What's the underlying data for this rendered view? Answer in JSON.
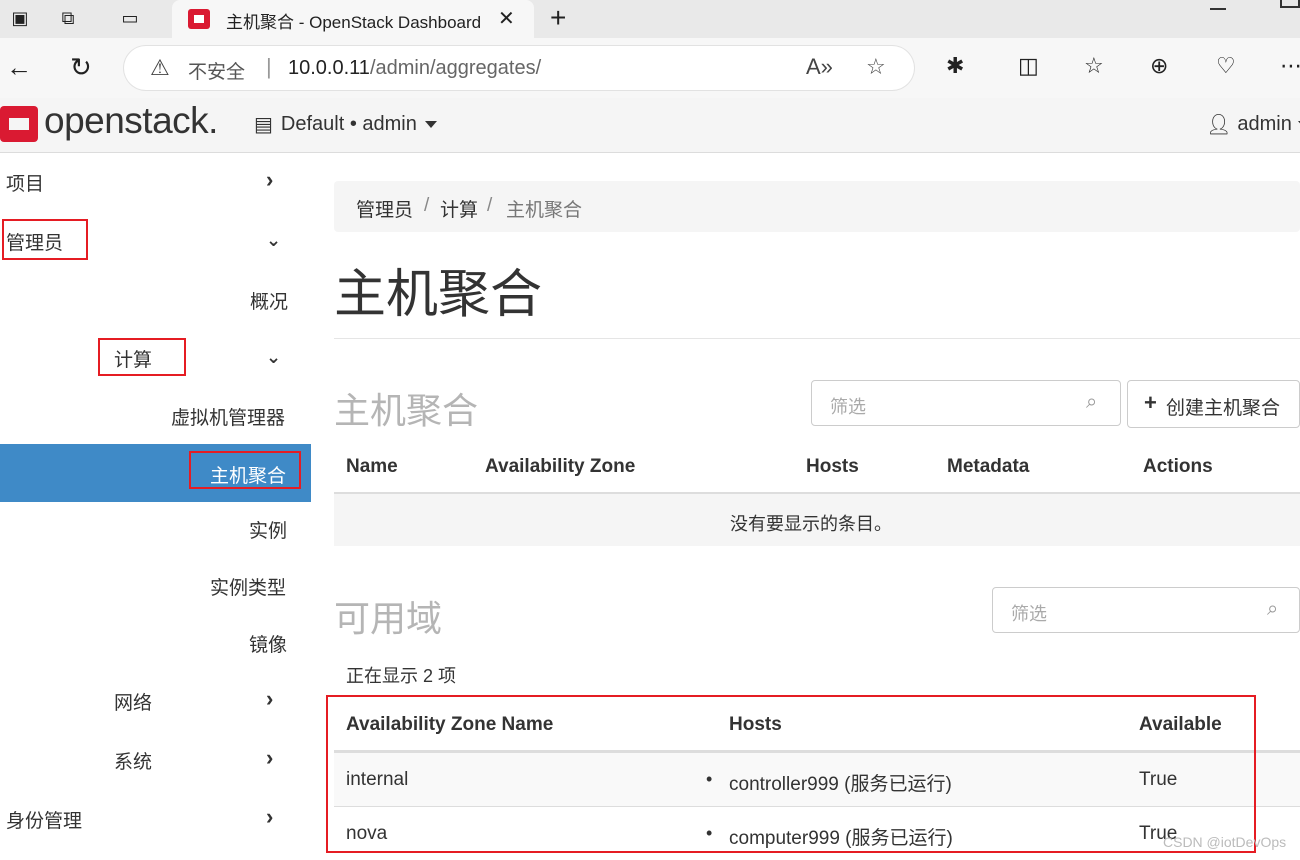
{
  "browser": {
    "tab_title": "主机聚合 - OpenStack Dashboard",
    "new_tab_symbol": "+",
    "security_label": "不安全",
    "url_host": "10.0.0.11",
    "url_path": "/admin/aggregates/"
  },
  "header": {
    "logo": "openstack.",
    "project": "Default • admin",
    "user": "admin"
  },
  "sidebar": {
    "items": [
      {
        "label": "项目"
      },
      {
        "label": "管理员"
      },
      {
        "label": "概况"
      },
      {
        "label": "计算"
      },
      {
        "label": "虚拟机管理器"
      },
      {
        "label": "主机聚合"
      },
      {
        "label": "实例"
      },
      {
        "label": "实例类型"
      },
      {
        "label": "镜像"
      },
      {
        "label": "网络"
      },
      {
        "label": "系统"
      },
      {
        "label": "身份管理"
      }
    ]
  },
  "breadcrumb": [
    "管理员",
    "计算",
    "主机聚合"
  ],
  "page_title": "主机聚合",
  "aggregates": {
    "title": "主机聚合",
    "filter_placeholder": "筛选",
    "create_label": "创建主机聚合",
    "columns": [
      "Name",
      "Availability Zone",
      "Hosts",
      "Metadata",
      "Actions"
    ],
    "empty_text": "没有要显示的条目。"
  },
  "zones": {
    "title": "可用域",
    "filter_placeholder": "筛选",
    "count_text": "正在显示 2 项",
    "columns": [
      "Availability Zone Name",
      "Hosts",
      "Available"
    ],
    "rows": [
      {
        "name": "internal",
        "host": "controller999 (服务已运行)",
        "available": "True"
      },
      {
        "name": "nova",
        "host": "computer999 (服务已运行)",
        "available": "True"
      }
    ]
  },
  "watermark": "CSDN @iotDevOps",
  "colors": {
    "brand_red": "#da1a32",
    "active_blue": "#3f8ac7",
    "highlight_red": "#e51c23"
  }
}
